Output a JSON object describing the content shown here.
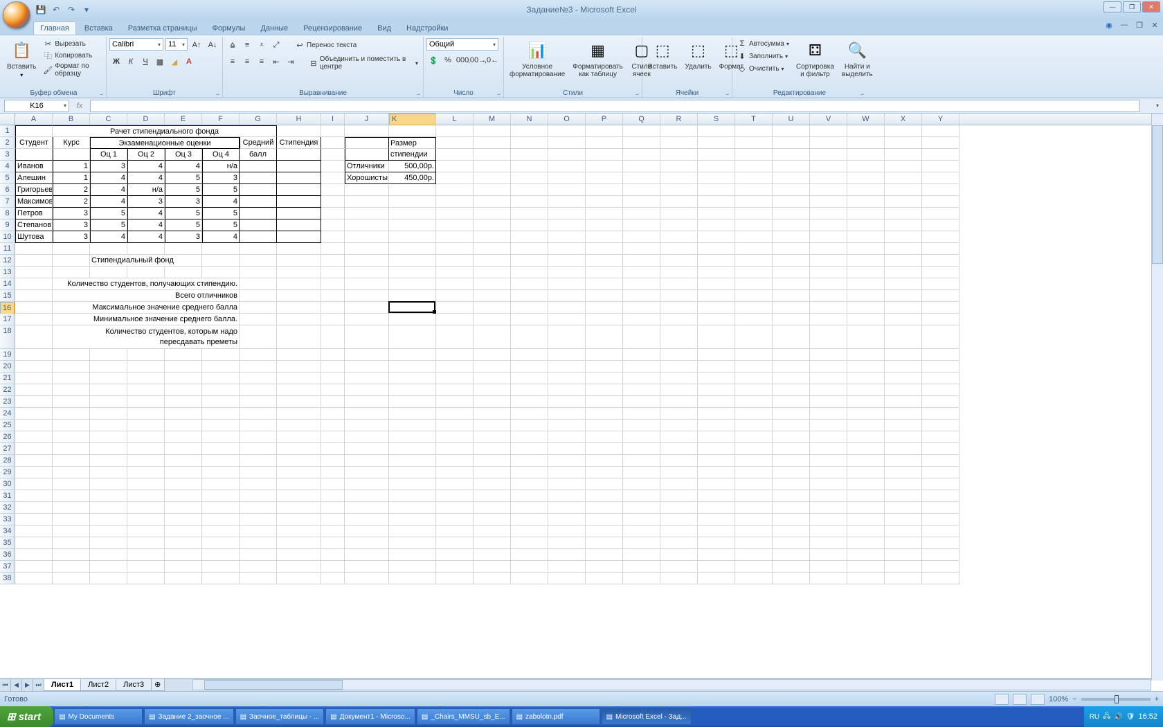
{
  "title": "Задание№3 - Microsoft Excel",
  "qat": {
    "save": "💾",
    "undo": "↶",
    "redo": "↷"
  },
  "tabs": [
    "Главная",
    "Вставка",
    "Разметка страницы",
    "Формулы",
    "Данные",
    "Рецензирование",
    "Вид",
    "Надстройки"
  ],
  "ribbon": {
    "clipboard": {
      "label": "Буфер обмена",
      "paste": "Вставить",
      "cut": "Вырезать",
      "copy": "Копировать",
      "format_painter": "Формат по образцу"
    },
    "font": {
      "label": "Шрифт",
      "name": "Calibri",
      "size": "11"
    },
    "align": {
      "label": "Выравнивание",
      "wrap": "Перенос текста",
      "merge": "Объединить и поместить в центре"
    },
    "number": {
      "label": "Число",
      "format": "Общий"
    },
    "styles": {
      "label": "Стили",
      "cond": "Условное форматирование",
      "table": "Форматировать как таблицу",
      "cell": "Стили ячеек"
    },
    "cells": {
      "label": "Ячейки",
      "insert": "Вставить",
      "delete": "Удалить",
      "format": "Формат"
    },
    "editing": {
      "label": "Редактирование",
      "sum": "Автосумма",
      "fill": "Заполнить",
      "clear": "Очистить",
      "sort": "Сортировка и фильтр",
      "find": "Найти и выделить"
    }
  },
  "namebox": "K16",
  "columns": [
    "A",
    "B",
    "C",
    "D",
    "E",
    "F",
    "G",
    "H",
    "I",
    "J",
    "K",
    "L",
    "M",
    "N",
    "O",
    "P",
    "Q",
    "R",
    "S",
    "T",
    "U",
    "V",
    "W",
    "X",
    "Y"
  ],
  "selected_col": "K",
  "selected_row": 16,
  "sheet_data": {
    "title": "Рачет стипендиального фонда",
    "hdr_student": "Студент",
    "hdr_course": "Курс",
    "hdr_exam": "Экзаменационные оценки",
    "hdr_o1": "Оц 1",
    "hdr_o2": "Оц 2",
    "hdr_o3": "Оц 3",
    "hdr_o4": "Оц 4",
    "hdr_avg1": "Средний",
    "hdr_avg2": "балл",
    "hdr_stip": "Стипендия",
    "rows": [
      {
        "n": "Иванов",
        "k": "1",
        "o1": "3",
        "o2": "4",
        "o3": "4",
        "o4": "н/а"
      },
      {
        "n": "Алешин",
        "k": "1",
        "o1": "4",
        "o2": "4",
        "o3": "5",
        "o4": "3"
      },
      {
        "n": "Григорьев",
        "k": "2",
        "o1": "4",
        "o2": "н/а",
        "o3": "5",
        "o4": "5"
      },
      {
        "n": "Максимов",
        "k": "2",
        "o1": "4",
        "o2": "3",
        "o3": "3",
        "o4": "4"
      },
      {
        "n": "Петров",
        "k": "3",
        "o1": "5",
        "o2": "4",
        "o3": "5",
        "o4": "5"
      },
      {
        "n": "Степанов",
        "k": "3",
        "o1": "5",
        "o2": "4",
        "o3": "5",
        "o4": "5"
      },
      {
        "n": "Шутова",
        "k": "3",
        "o1": "4",
        "o2": "4",
        "o3": "3",
        "o4": "4"
      }
    ],
    "side_hdr1": "Размер",
    "side_hdr2": "стипендии",
    "side_excellent": "Отличники",
    "side_excellent_v": "500,00р.",
    "side_good": "Хорошисты",
    "side_good_v": "450,00р.",
    "fund": "Стипендиальный фонд",
    "txt14": "Количество студентов, получающих стипендию.",
    "txt15": "Всего отличников",
    "txt16": "Максимальное значение среднего балла",
    "txt17": "Минимальное значение среднего балла.",
    "txt18a": "Количество студентов, которым надо",
    "txt18b": "пересдавать преметы"
  },
  "sheets": [
    "Лист1",
    "Лист2",
    "Лист3"
  ],
  "status": "Готово",
  "zoom": "100%",
  "taskbar": {
    "start": "start",
    "items": [
      "My Documents",
      "Задание 2_заочное ...",
      "Заочное_таблицы - ...",
      "Документ1 - Microso...",
      "_Chairs_MMSU_sb_E...",
      "zabolotn.pdf",
      "Microsoft Excel - Зад..."
    ],
    "lang": "RU",
    "time": "16:52"
  }
}
